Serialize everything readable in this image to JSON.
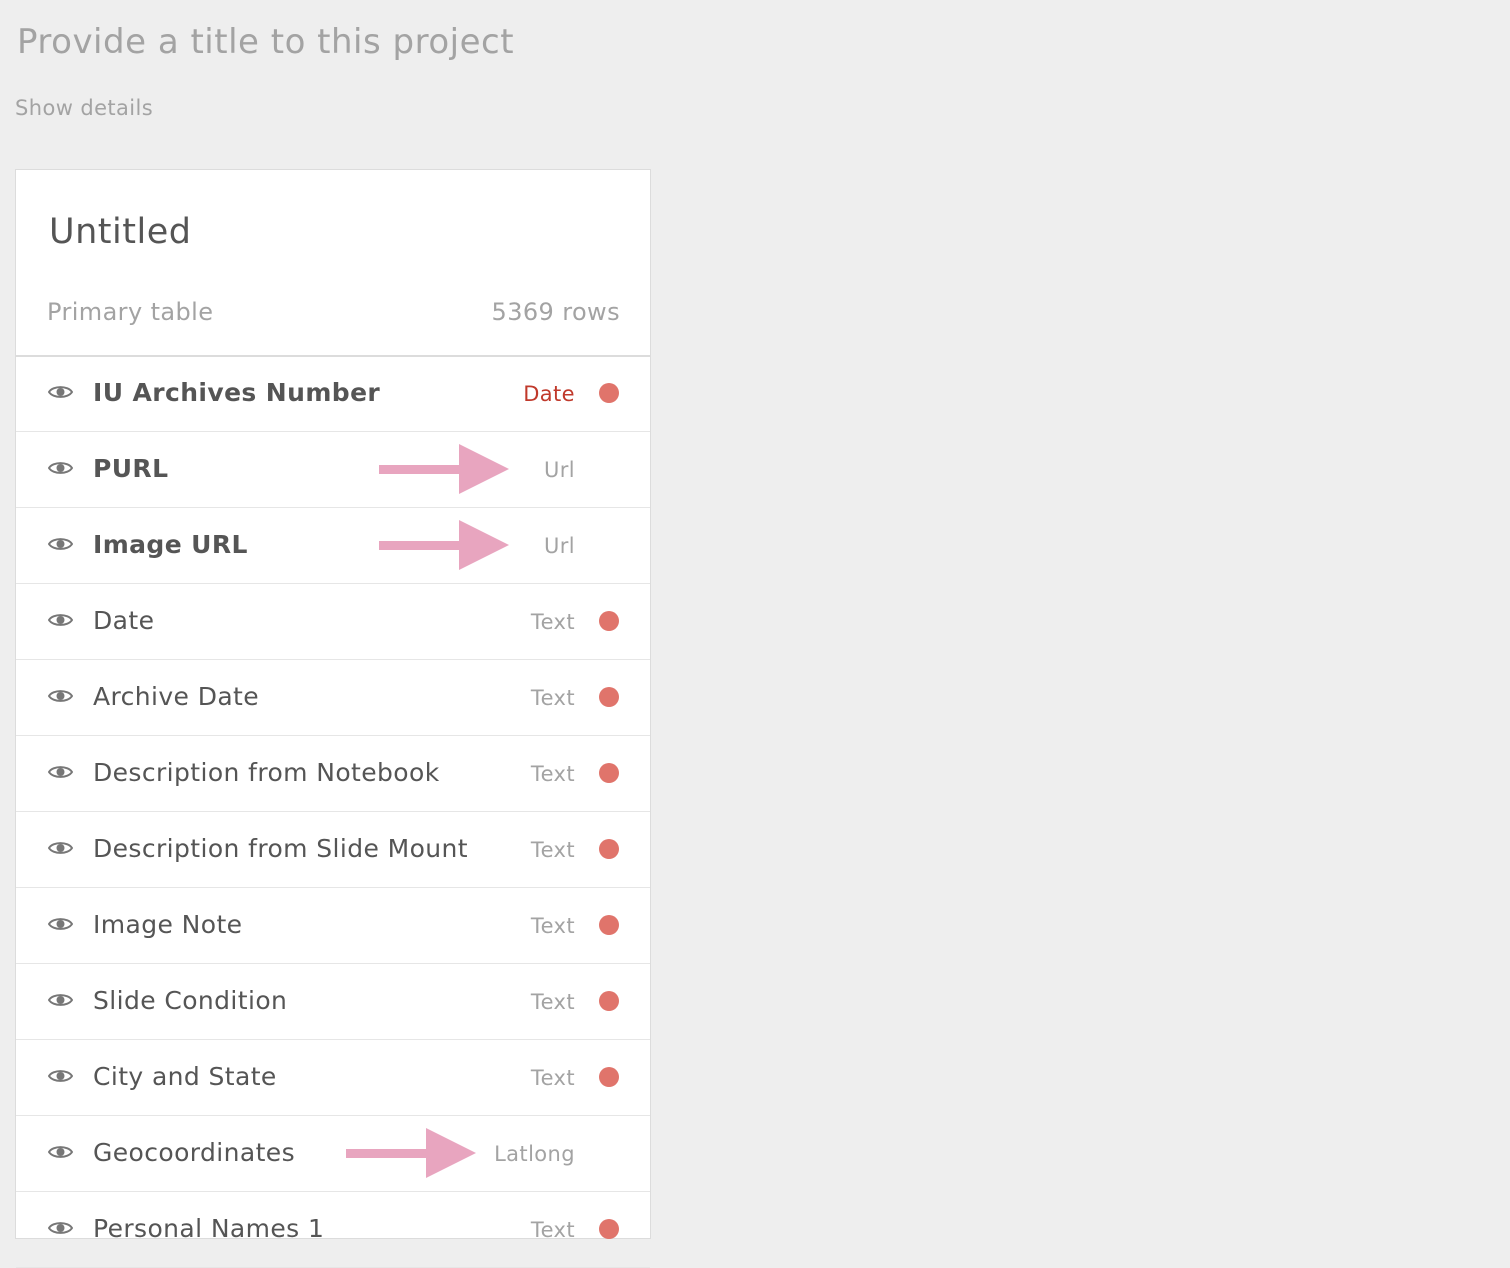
{
  "project": {
    "title_placeholder": "Provide a title to this project",
    "show_details": "Show details"
  },
  "panel": {
    "title": "Untitled",
    "table_label": "Primary table",
    "row_count": "5369 rows"
  },
  "colors": {
    "dot": "#e0746b",
    "warn_type": "#c0392b",
    "annotation_arrow": "#e8a5bf"
  },
  "columns": [
    {
      "name": "IU Archives Number",
      "type": "Date",
      "bold": true,
      "dot": true,
      "warn": true,
      "arrow": false
    },
    {
      "name": "PURL",
      "type": "Url",
      "bold": true,
      "dot": false,
      "warn": false,
      "arrow": true
    },
    {
      "name": "Image URL",
      "type": "Url",
      "bold": true,
      "dot": false,
      "warn": false,
      "arrow": true
    },
    {
      "name": "Date",
      "type": "Text",
      "bold": false,
      "dot": true,
      "warn": false,
      "arrow": false
    },
    {
      "name": "Archive Date",
      "type": "Text",
      "bold": false,
      "dot": true,
      "warn": false,
      "arrow": false
    },
    {
      "name": "Description from Notebook",
      "type": "Text",
      "bold": false,
      "dot": true,
      "warn": false,
      "arrow": false
    },
    {
      "name": "Description from Slide Mount",
      "type": "Text",
      "bold": false,
      "dot": true,
      "warn": false,
      "arrow": false
    },
    {
      "name": "Image Note",
      "type": "Text",
      "bold": false,
      "dot": true,
      "warn": false,
      "arrow": false
    },
    {
      "name": "Slide Condition",
      "type": "Text",
      "bold": false,
      "dot": true,
      "warn": false,
      "arrow": false
    },
    {
      "name": "City and State",
      "type": "Text",
      "bold": false,
      "dot": true,
      "warn": false,
      "arrow": false
    },
    {
      "name": "Geocoordinates",
      "type": "Latlong",
      "bold": false,
      "dot": false,
      "warn": false,
      "arrow": true
    },
    {
      "name": "Personal Names 1",
      "type": "Text",
      "bold": false,
      "dot": true,
      "warn": false,
      "arrow": false
    }
  ]
}
